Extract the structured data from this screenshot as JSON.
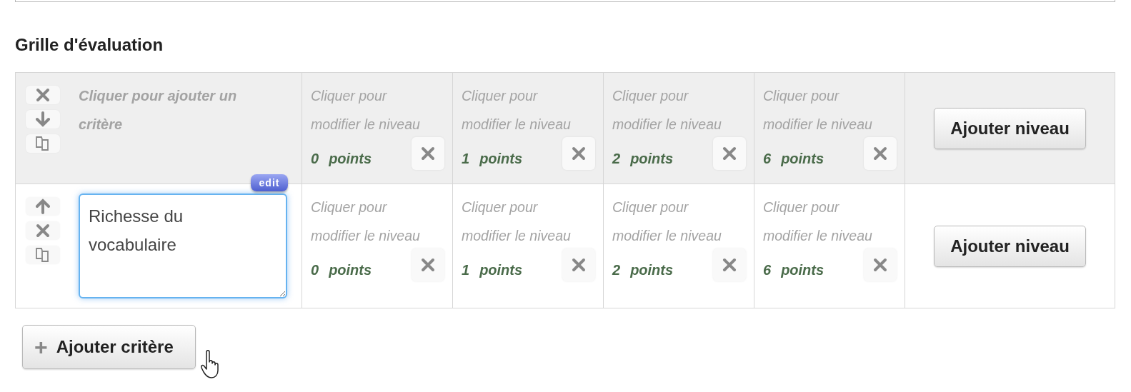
{
  "heading": "Grille d'évaluation",
  "rows": [
    {
      "highlighted": true,
      "actions": [
        {
          "kind": "delete"
        },
        {
          "kind": "down"
        },
        {
          "kind": "copy"
        }
      ],
      "criterion": {
        "kind": "placeholder",
        "text": "Cliquer pour ajouter un critère"
      },
      "levels": [
        {
          "text": "Cliquer pour modifier le niveau",
          "score": "0",
          "unit": "points"
        },
        {
          "text": "Cliquer pour modifier le niveau",
          "score": "1",
          "unit": "points"
        },
        {
          "text": "Cliquer pour modifier le niveau",
          "score": "2",
          "unit": "points"
        },
        {
          "text": "Cliquer pour modifier le niveau",
          "score": "6",
          "unit": "points"
        }
      ],
      "add_level": "Ajouter niveau"
    },
    {
      "highlighted": false,
      "actions": [
        {
          "kind": "up"
        },
        {
          "kind": "delete"
        },
        {
          "kind": "copy"
        }
      ],
      "criterion": {
        "kind": "field",
        "text": "Richesse du vocabulaire",
        "badge": "edit"
      },
      "levels": [
        {
          "text": "Cliquer pour modifier le niveau",
          "score": "0",
          "unit": "points"
        },
        {
          "text": "Cliquer pour modifier le niveau",
          "score": "1",
          "unit": "points"
        },
        {
          "text": "Cliquer pour modifier le niveau",
          "score": "2",
          "unit": "points"
        },
        {
          "text": "Cliquer pour modifier le niveau",
          "score": "6",
          "unit": "points"
        }
      ],
      "add_level": "Ajouter niveau"
    }
  ],
  "add_criterion": {
    "icon": "+",
    "label": "Ajouter critère"
  }
}
